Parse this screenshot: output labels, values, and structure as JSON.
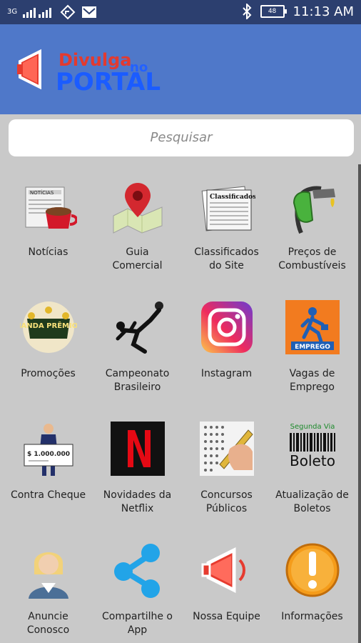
{
  "status": {
    "carrier": "3G",
    "battery": "48",
    "time": "11:13 AM"
  },
  "header": {
    "logo_top": "Divulga",
    "logo_small": "no",
    "logo_bottom": "PORTAL"
  },
  "search": {
    "placeholder": "Pesquisar"
  },
  "menu": [
    {
      "line1": "Notícias",
      "line2": "",
      "icon": "newspaper-coffee-icon"
    },
    {
      "line1": "Guia",
      "line2": "Comercial",
      "icon": "map-pin-icon"
    },
    {
      "line1": "Classificados",
      "line2": "do Site",
      "icon": "classifieds-newspaper-icon"
    },
    {
      "line1": "Preços de",
      "line2": "Combustíveis",
      "icon": "fuel-nozzle-icon"
    },
    {
      "line1": "Promoções",
      "line2": "",
      "icon": "promotion-badge-icon"
    },
    {
      "line1": "Campeonato",
      "line2": "Brasileiro",
      "icon": "soccer-player-icon"
    },
    {
      "line1": "Instagram",
      "line2": "",
      "icon": "instagram-icon"
    },
    {
      "line1": "Vagas de",
      "line2": "Emprego",
      "icon": "employment-icon"
    },
    {
      "line1": "Contra Cheque",
      "line2": "",
      "icon": "paycheck-icon"
    },
    {
      "line1": "Novidades da",
      "line2": "Netflix",
      "icon": "netflix-icon"
    },
    {
      "line1": "Concursos",
      "line2": "Públicos",
      "icon": "exam-icon"
    },
    {
      "line1": "Atualização de",
      "line2": "Boletos",
      "icon": "boleto-icon"
    },
    {
      "line1": "Anuncie",
      "line2": "Conosco",
      "icon": "person-icon"
    },
    {
      "line1": "Compartilhe o",
      "line2": "App",
      "icon": "share-icon"
    },
    {
      "line1": "Nossa Equipe",
      "line2": "",
      "icon": "megaphone-icon"
    },
    {
      "line1": "Informações",
      "line2": "",
      "icon": "info-icon"
    }
  ],
  "badges": {
    "promo": "MANDA PRÊMIOS",
    "emprego": "EMPREGO",
    "boleto_top": "Segunda Via",
    "boleto_bottom": "Boleto",
    "classificados": "Classificados",
    "noticias": "NOTÍCIAS",
    "check_amount": "$ 1.000.000"
  }
}
